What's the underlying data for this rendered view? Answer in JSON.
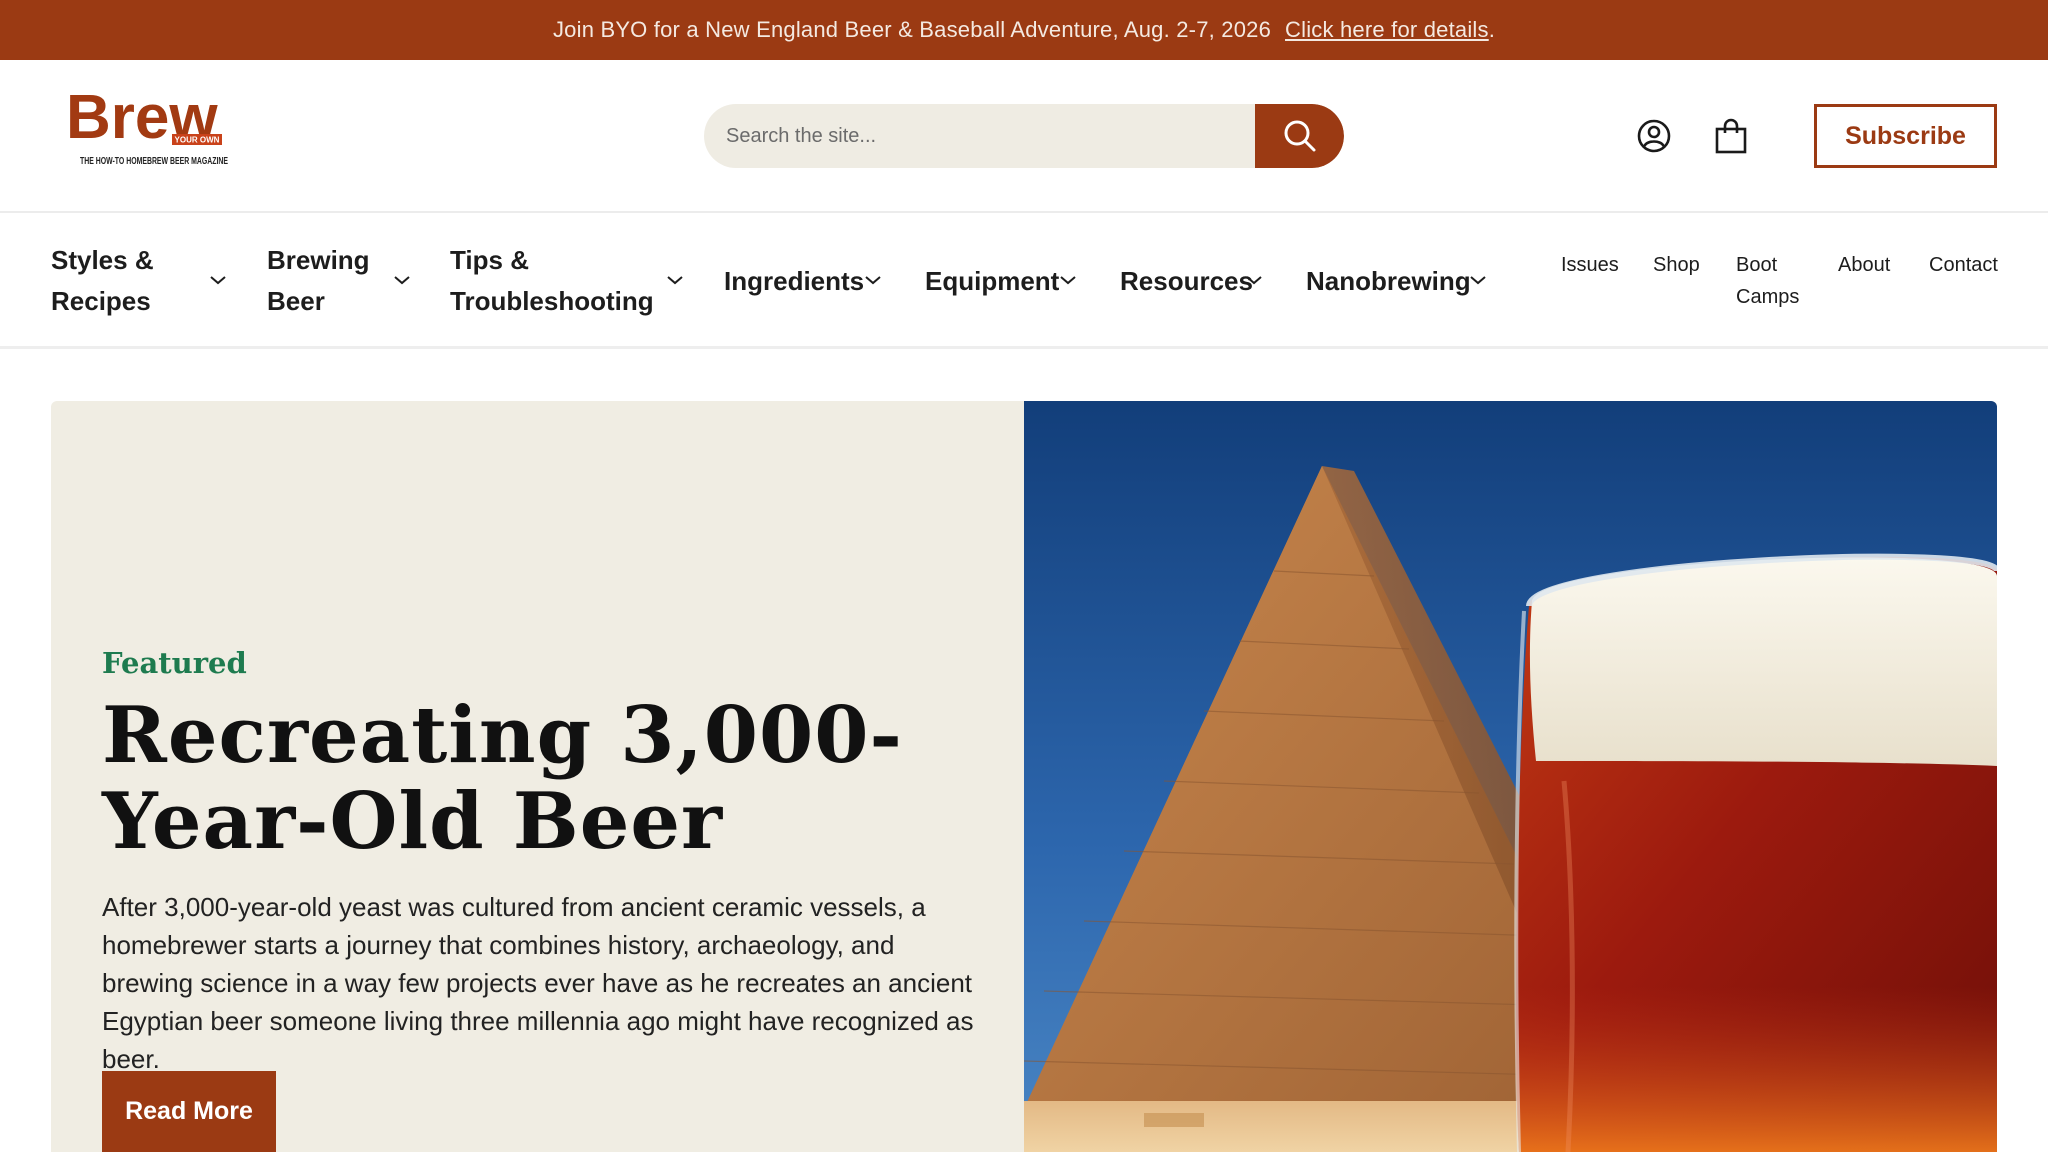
{
  "announcement": {
    "text": "Join BYO for a New England Beer & Baseball Adventure, Aug. 2-7, 2026",
    "link": "Click here for details",
    "suffix": "."
  },
  "header": {
    "logo_alt": "Brew Your Own - The How-To Homebrew Beer Magazine",
    "logo_word": "Brew",
    "logo_badge": "YOUR OWN",
    "logo_tagline": "THE HOW-TO HOMEBREW BEER MAGAZINE",
    "search_placeholder": "Search the site...",
    "subscribe_label": "Subscribe",
    "icons": [
      "search-icon",
      "account-icon",
      "cart-bag-icon"
    ]
  },
  "nav": {
    "primary": [
      {
        "line1": "Styles &",
        "line2": "Recipes"
      },
      {
        "line1": "Brewing",
        "line2": "Beer"
      },
      {
        "line1": "Tips &",
        "line2": "Troubleshooting"
      },
      {
        "line1": "Ingredients",
        "line2": ""
      },
      {
        "line1": "Equipment",
        "line2": ""
      },
      {
        "line1": "Resources",
        "line2": ""
      },
      {
        "line1": "Nanobrewing",
        "line2": ""
      }
    ],
    "secondary": [
      {
        "line1": "Issues",
        "line2": ""
      },
      {
        "line1": "Shop",
        "line2": ""
      },
      {
        "line1": "Boot",
        "line2": "Camps"
      },
      {
        "line1": "About",
        "line2": ""
      },
      {
        "line1": "Contact",
        "line2": ""
      }
    ]
  },
  "hero": {
    "eyebrow": "Featured",
    "title": "Recreating 3,000-Year-Old Beer",
    "description": "After 3,000-year-old yeast was cultured from ancient ceramic vessels, a homebrewer starts a journey that combines history, archaeology, and brewing science in a way few projects ever have as he recreates an ancient Egyptian beer someone living three millennia ago might have recognized as beer.",
    "cta_label": "Read More",
    "image_alt": "pyramid and glass of amber beer"
  },
  "colors": {
    "brand_rust": "#9b3a13",
    "featured_green": "#1e7b4f",
    "hero_bg": "#f0ede3"
  }
}
